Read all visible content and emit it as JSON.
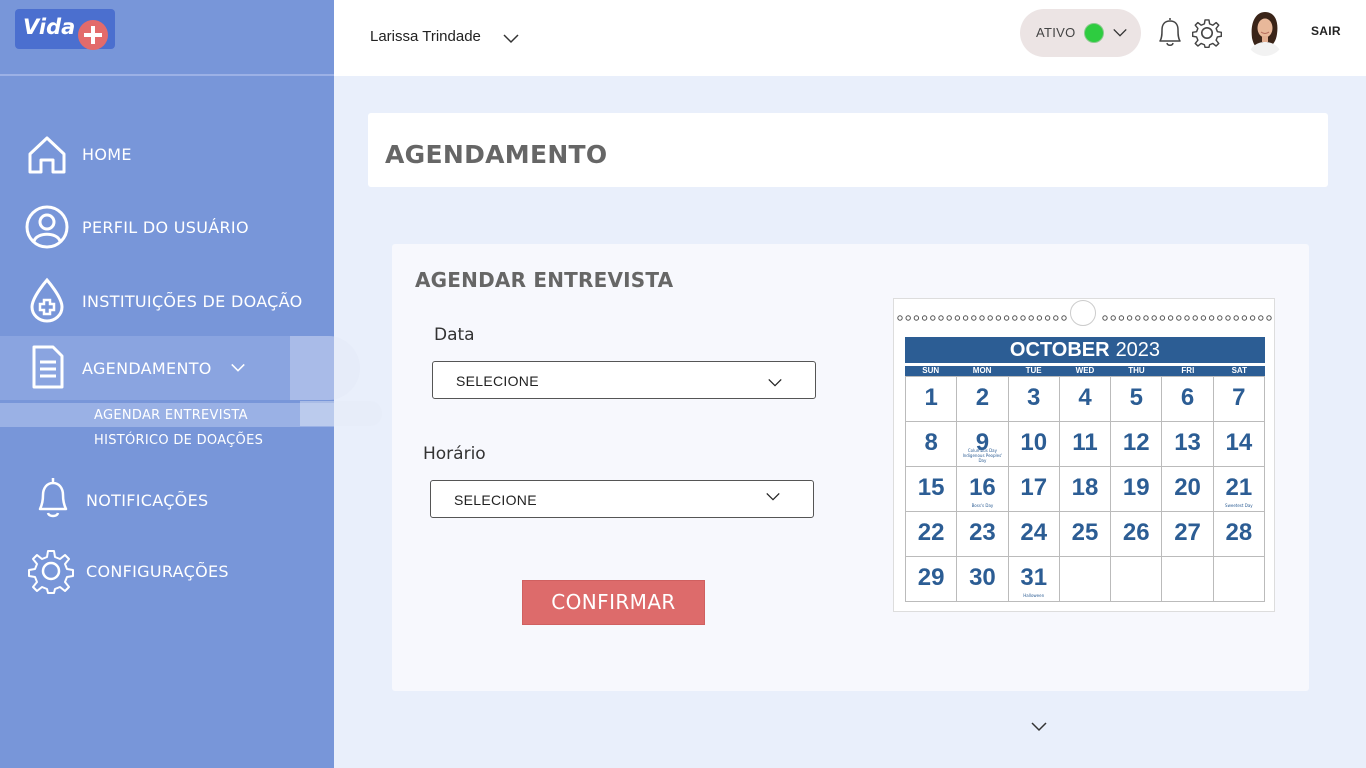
{
  "sidebar": {
    "logo_text": "Vida",
    "items": [
      {
        "label": "HOME"
      },
      {
        "label": "PERFIL DO USUÁRIO"
      },
      {
        "label": "INSTITUIÇÕES DE DOAÇÃO"
      },
      {
        "label": "AGENDAMENTO"
      },
      {
        "label": "NOTIFICAÇÕES"
      },
      {
        "label": "CONFIGURAÇÕES"
      }
    ],
    "subitems": [
      {
        "label": "AGENDAR ENTREVISTA"
      },
      {
        "label": "HISTÓRICO DE DOAÇÕES"
      }
    ]
  },
  "header": {
    "user_name": "Larissa Trindade",
    "status": "ATIVO",
    "status_color": "#2ecc40",
    "logout": "SAIR"
  },
  "page": {
    "title": "AGENDAMENTO"
  },
  "form": {
    "title": "AGENDAR ENTREVISTA",
    "date_label": "Data",
    "date_value": "SELECIONE",
    "time_label": "Horário",
    "time_value": "SELECIONE",
    "confirm": "CONFIRMAR"
  },
  "calendar": {
    "month": "OCTOBER",
    "year": "2023",
    "weekdays": [
      "SUN",
      "MON",
      "TUE",
      "WED",
      "THU",
      "FRI",
      "SAT"
    ],
    "days": [
      {
        "d": "1"
      },
      {
        "d": "2"
      },
      {
        "d": "3"
      },
      {
        "d": "4"
      },
      {
        "d": "5"
      },
      {
        "d": "6"
      },
      {
        "d": "7"
      },
      {
        "d": "8"
      },
      {
        "d": "9",
        "note": "Columbus Day Indigenous Peoples' Day"
      },
      {
        "d": "10"
      },
      {
        "d": "11"
      },
      {
        "d": "12"
      },
      {
        "d": "13"
      },
      {
        "d": "14"
      },
      {
        "d": "15"
      },
      {
        "d": "16",
        "note": "Boss's Day"
      },
      {
        "d": "17"
      },
      {
        "d": "18"
      },
      {
        "d": "19"
      },
      {
        "d": "20"
      },
      {
        "d": "21",
        "note": "Sweetest Day"
      },
      {
        "d": "22"
      },
      {
        "d": "23"
      },
      {
        "d": "24"
      },
      {
        "d": "25"
      },
      {
        "d": "26"
      },
      {
        "d": "27"
      },
      {
        "d": "28"
      },
      {
        "d": "29"
      },
      {
        "d": "30"
      },
      {
        "d": "31",
        "note": "Halloween"
      },
      {
        "d": ""
      },
      {
        "d": ""
      },
      {
        "d": ""
      },
      {
        "d": ""
      }
    ]
  },
  "colors": {
    "sidebar_bg": "#7896d9",
    "content_bg": "#e9effb",
    "accent_red": "#dd6b6b",
    "calendar_blue": "#2c5d94"
  }
}
